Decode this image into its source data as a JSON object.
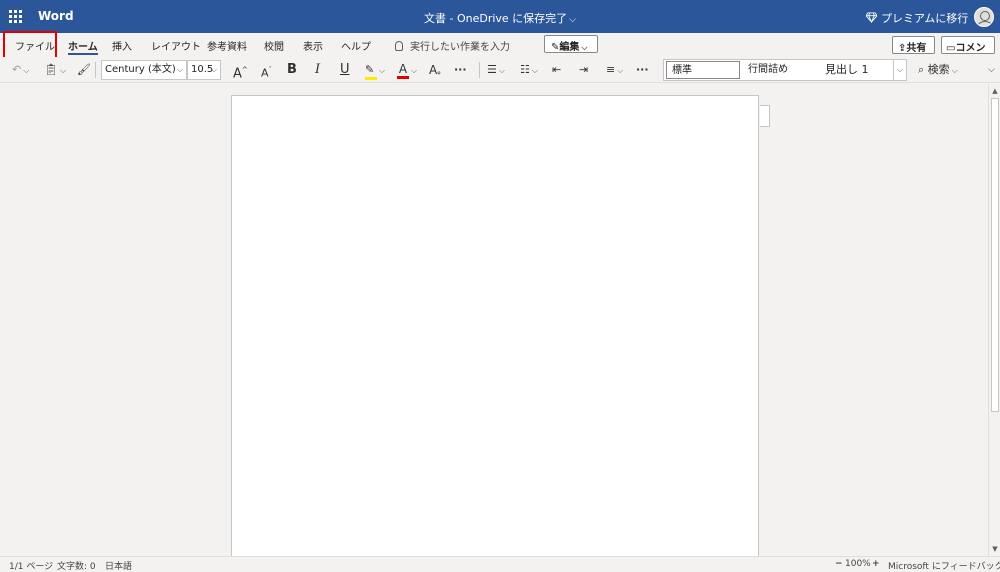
{
  "titlebar": {
    "app_name": "Word",
    "doc_title": "文書 - OneDrive に保存完了",
    "premium": "プレミアムに移行",
    "bg_color": "#2b579a"
  },
  "tabs": [
    {
      "label": "ファイル"
    },
    {
      "label": "ホーム"
    },
    {
      "label": "挿入"
    },
    {
      "label": "レイアウト"
    },
    {
      "label": "参考資料"
    },
    {
      "label": "校閲"
    },
    {
      "label": "表示"
    },
    {
      "label": "ヘルプ"
    }
  ],
  "tellme": "実行したい作業を入力",
  "edit_mode": "編集",
  "share": "共有",
  "comment": "コメント",
  "toolbar": {
    "font_name": "Century (本文)",
    "font_size": "10.5",
    "bold": "B",
    "italic": "I",
    "underline": "U",
    "more": "···",
    "grow_font": "A",
    "shrink_font": "A",
    "font_color": "A",
    "text_effects": "A"
  },
  "styles": {
    "items": [
      "標準",
      "行間詰め",
      "見出し 1"
    ],
    "selected": "標準"
  },
  "search": "検索",
  "statusbar": {
    "page": "1/1 ページ",
    "word_count": "文字数: 0",
    "language": "日本語",
    "zoom": "100%",
    "feedback": "Microsoft にフィードバックを送信"
  },
  "colors": {
    "highlight": "#ffeb00",
    "font_color": "#e00000",
    "accent": "#2b579a",
    "annotation": "#e00000"
  }
}
